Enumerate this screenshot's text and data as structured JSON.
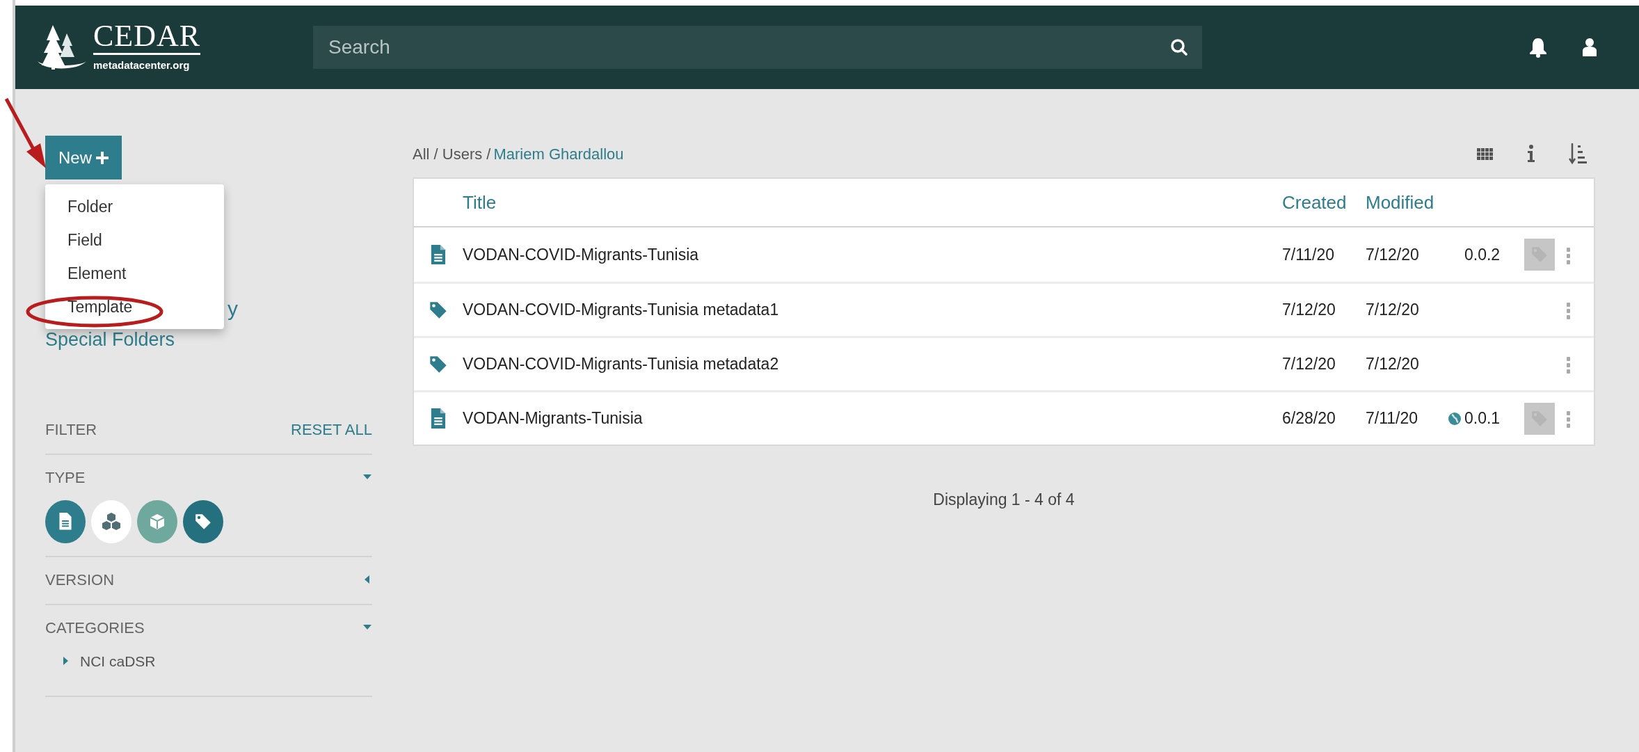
{
  "header": {
    "logo": {
      "name": "CEDAR",
      "subtitle": "metadatacenter.org"
    },
    "search": {
      "placeholder": "Search"
    }
  },
  "sidebar": {
    "new_button": {
      "label": "New"
    },
    "new_menu": {
      "expanded": true,
      "items": [
        {
          "label": "Folder"
        },
        {
          "label": "Field"
        },
        {
          "label": "Element"
        },
        {
          "label": "Template"
        }
      ]
    },
    "nav_items": [
      {
        "label": "y",
        "kind": "hidden-tail"
      },
      {
        "label": "Special Folders",
        "kind": "link"
      }
    ],
    "filter": {
      "title": "FILTER",
      "reset": "RESET ALL",
      "sections": [
        {
          "title": "TYPE",
          "expanded": true,
          "kind": "types",
          "types": [
            {
              "kind": "template",
              "selected": true
            },
            {
              "kind": "element",
              "selected": false
            },
            {
              "kind": "field",
              "selected": true
            },
            {
              "kind": "instance",
              "selected": true
            }
          ]
        },
        {
          "title": "VERSION",
          "expanded": false
        },
        {
          "title": "CATEGORIES",
          "expanded": true,
          "kind": "tree",
          "children": [
            {
              "label": "NCI caDSR",
              "expanded": false
            }
          ]
        }
      ]
    }
  },
  "breadcrumb": {
    "path": "All / Users /",
    "current": "Mariem Ghardallou"
  },
  "table": {
    "columns": [
      "Title",
      "Created",
      "Modified"
    ],
    "rows": [
      {
        "kind": "template",
        "title": "VODAN-COVID-Migrants-Tunisia",
        "created": "7/11/20",
        "modified": "7/12/20",
        "version": "0.0.2",
        "published": false,
        "tagged": true
      },
      {
        "kind": "instance",
        "title": "VODAN-COVID-Migrants-Tunisia metadata1",
        "created": "7/12/20",
        "modified": "7/12/20",
        "tagged": false
      },
      {
        "kind": "instance",
        "title": "VODAN-COVID-Migrants-Tunisia metadata2",
        "created": "7/12/20",
        "modified": "7/12/20",
        "tagged": false
      },
      {
        "kind": "template",
        "title": "VODAN-Migrants-Tunisia",
        "created": "6/28/20",
        "modified": "7/11/20",
        "version": "0.0.1",
        "published": true,
        "tagged": true
      }
    ]
  },
  "footer": {
    "text": "Displaying 1 - 4 of 4"
  },
  "annotations": {
    "arrow": true,
    "ellipse": true
  }
}
